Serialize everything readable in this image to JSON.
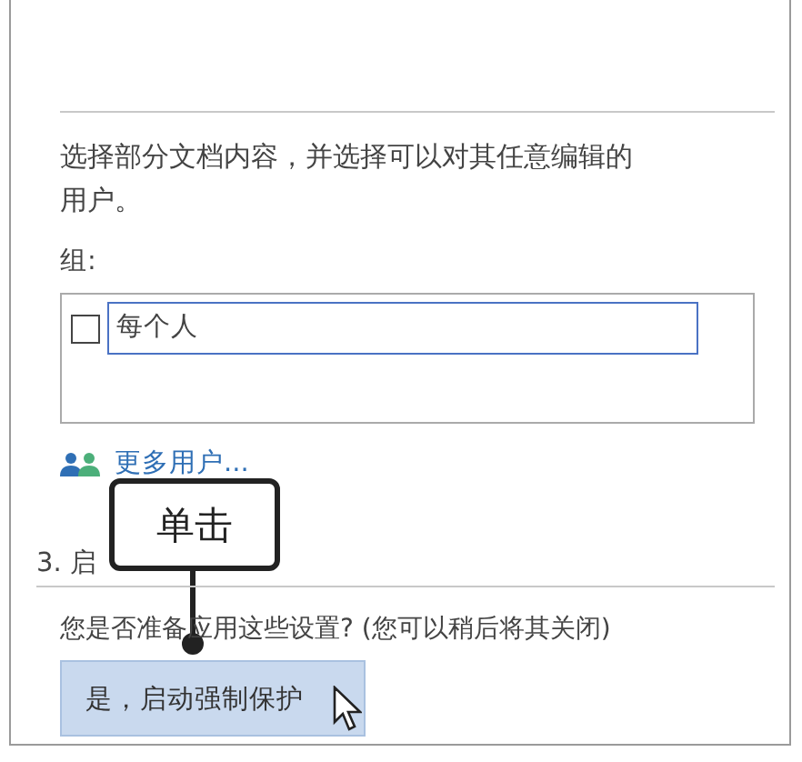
{
  "instruction": "选择部分文档内容，并选择可以对其任意编辑的用户。",
  "group_label": "组:",
  "groups": [
    {
      "name": "每个人",
      "checked": false
    }
  ],
  "more_users_link": "更多用户...",
  "section_heading": "3. 启",
  "question": "您是否准备应用这些设置? (您可以稍后将其关闭)",
  "apply_button": "是，启动强制保护",
  "callout": "单击"
}
